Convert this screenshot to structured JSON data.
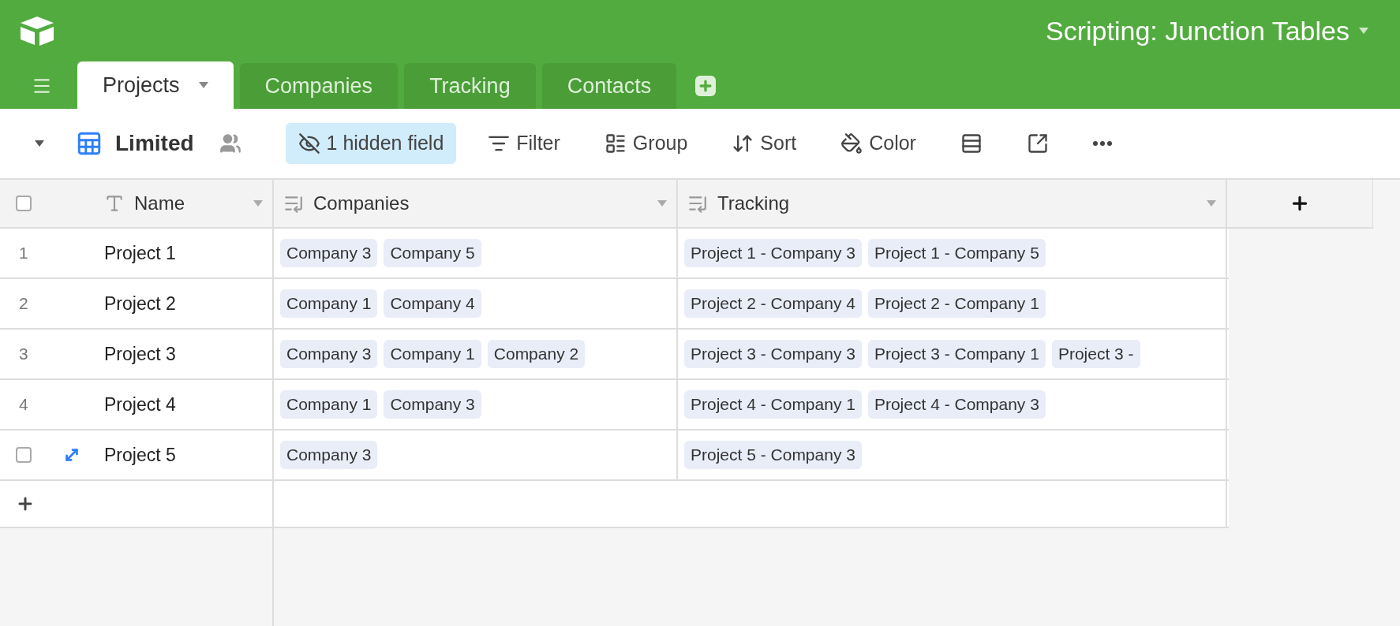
{
  "base": {
    "title": "Scripting: Junction Tables"
  },
  "tabs": [
    {
      "label": "Projects",
      "selected": true
    },
    {
      "label": "Companies",
      "selected": false
    },
    {
      "label": "Tracking",
      "selected": false
    },
    {
      "label": "Contacts",
      "selected": false
    }
  ],
  "view": {
    "name": "Limited"
  },
  "toolbar": [
    {
      "kind": "hide",
      "label": "1 hidden field",
      "active": true
    },
    {
      "kind": "filter",
      "label": "Filter",
      "active": false
    },
    {
      "kind": "group",
      "label": "Group",
      "active": false
    },
    {
      "kind": "sort",
      "label": "Sort",
      "active": false
    },
    {
      "kind": "color",
      "label": "Color",
      "active": false
    },
    {
      "kind": "height",
      "active": false
    },
    {
      "kind": "share",
      "active": false
    },
    {
      "kind": "more",
      "active": false
    }
  ],
  "table": {
    "select_all": {
      "checked": false
    },
    "columns": [
      {
        "kind": "text",
        "label": "Name"
      },
      {
        "kind": "link",
        "label": "Companies"
      },
      {
        "kind": "link",
        "label": "Tracking"
      }
    ],
    "rows": [
      {
        "number": "1",
        "hovered": false,
        "name": "Project 1",
        "companies": [
          "Company 3",
          "Company 5"
        ],
        "tracking": [
          "Project 1 - Company 3",
          "Project 1 - Company 5"
        ]
      },
      {
        "number": "2",
        "hovered": false,
        "name": "Project 2",
        "companies": [
          "Company 1",
          "Company 4"
        ],
        "tracking": [
          "Project 2 - Company 4",
          "Project 2 - Company 1"
        ]
      },
      {
        "number": "3",
        "hovered": false,
        "name": "Project 3",
        "companies": [
          "Company 3",
          "Company 1",
          "Company 2"
        ],
        "tracking": [
          "Project 3 - Company 3",
          "Project 3 - Company 1",
          "Project 3 -"
        ]
      },
      {
        "number": "4",
        "hovered": false,
        "name": "Project 4",
        "companies": [
          "Company 1",
          "Company 3"
        ],
        "tracking": [
          "Project 4 - Company 1",
          "Project 4 - Company 3"
        ]
      },
      {
        "hovered": true,
        "checked": false,
        "name": "Project 5",
        "companies": [
          "Company 3"
        ],
        "tracking": [
          "Project 5 - Company 3"
        ]
      }
    ]
  }
}
